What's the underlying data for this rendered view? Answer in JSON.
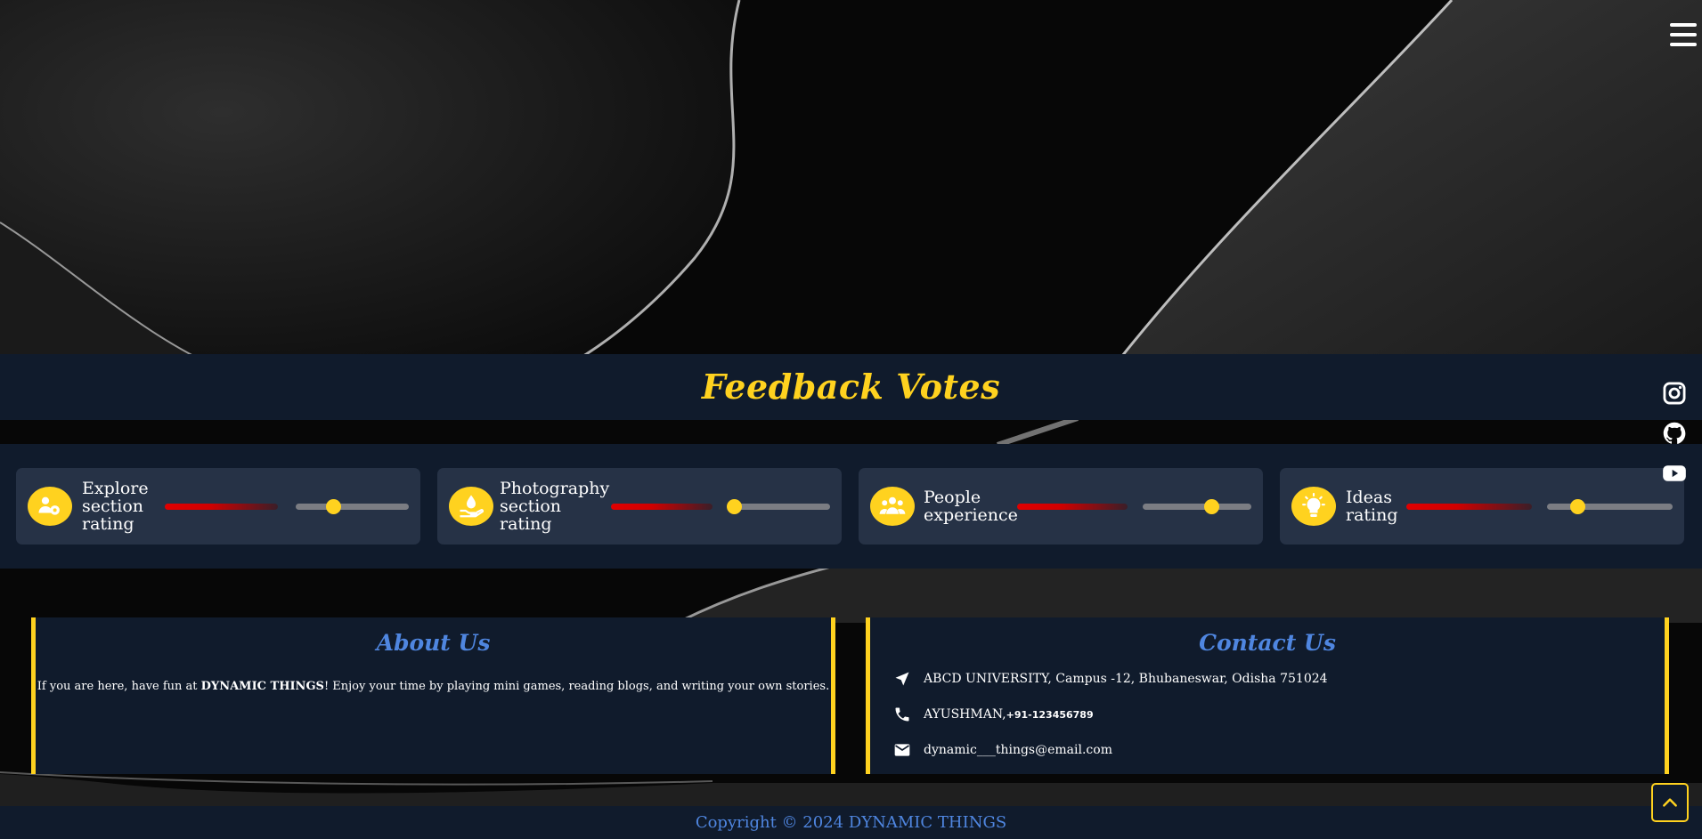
{
  "header": {
    "menu_icon": "hamburger-menu-icon"
  },
  "feedback": {
    "title": "Feedback Votes",
    "cards": [
      {
        "label": "Explore section rating",
        "icon": "people-gear-icon",
        "slider_value": 0.33
      },
      {
        "label": "Photography section rating",
        "icon": "hand-drop-icon",
        "slider_value": 0.06
      },
      {
        "label": "People experience",
        "icon": "people-group-icon",
        "slider_value": 0.63
      },
      {
        "label": "Ideas rating",
        "icon": "lightbulb-icon",
        "slider_value": 0.24
      }
    ]
  },
  "social": [
    {
      "name": "instagram",
      "icon": "instagram-icon"
    },
    {
      "name": "github",
      "icon": "github-icon"
    },
    {
      "name": "youtube",
      "icon": "youtube-icon"
    }
  ],
  "about": {
    "title": "About Us",
    "text_before": "If you are here, have fun at ",
    "brand": "DYNAMIC THINGS",
    "text_after": "! Enjoy your time by playing mini games, reading blogs, and writing your own stories."
  },
  "contact": {
    "title": "Contact Us",
    "address": "ABCD UNIVERSITY, Campus -12, Bhubaneswar, Odisha 751024",
    "phone_name": "AYUSHMAN, ",
    "phone_number": "+91-123456789",
    "email": "dynamic___things@email.com"
  },
  "footer": {
    "copyright": "Copyright © 2024 DYNAMIC THINGS"
  },
  "colors": {
    "accent": "#ffd21f",
    "panel_bg": "#101b2c",
    "card_bg": "#263246",
    "link_blue": "#4f86e0",
    "vote_red": "#e00000"
  }
}
